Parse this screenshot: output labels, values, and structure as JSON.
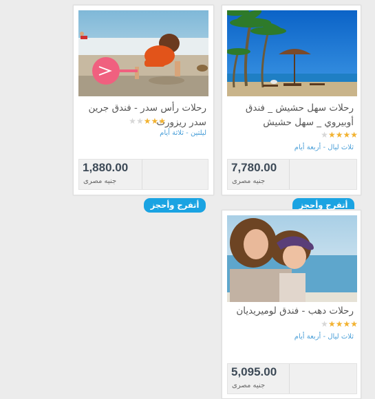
{
  "offers": [
    {
      "title": "رحلات سهل حشيش _ فندق أوبيروي _ سهل حشيش",
      "stars": 4,
      "duration": "ثلاث ليال - أربعة أيام",
      "price": "7,780.00",
      "currency": "جنيه مصرى",
      "button_label": "أتفرج وأحجز",
      "image_label": "beach-resort-palm-trees-photo"
    },
    {
      "title": "رحلات رأس سدر - فندق جرين سدر ريزورت",
      "stars": 3,
      "duration": "ليلتين - ثلاثة أيام",
      "price": "1,880.00",
      "currency": "جنيه مصرى",
      "button_label": "أتفرج وأحجز",
      "image_label": "child-playing-on-beach-photo"
    },
    {
      "title": "رحلات دهب - فندق لوميريديان",
      "stars": 4,
      "duration": "ثلاث ليال - أربعة أيام",
      "price": "5,095.00",
      "currency": "جنيه مصرى",
      "button_label": "",
      "image_label": "mother-and-daughter-at-sea-photo"
    }
  ],
  "colors": {
    "accent_button": "#1aa3e2",
    "star_on": "#f2b230",
    "star_off": "#d7d7d7",
    "duration_text": "#4a9fd8",
    "price_text": "#3d4a57"
  }
}
